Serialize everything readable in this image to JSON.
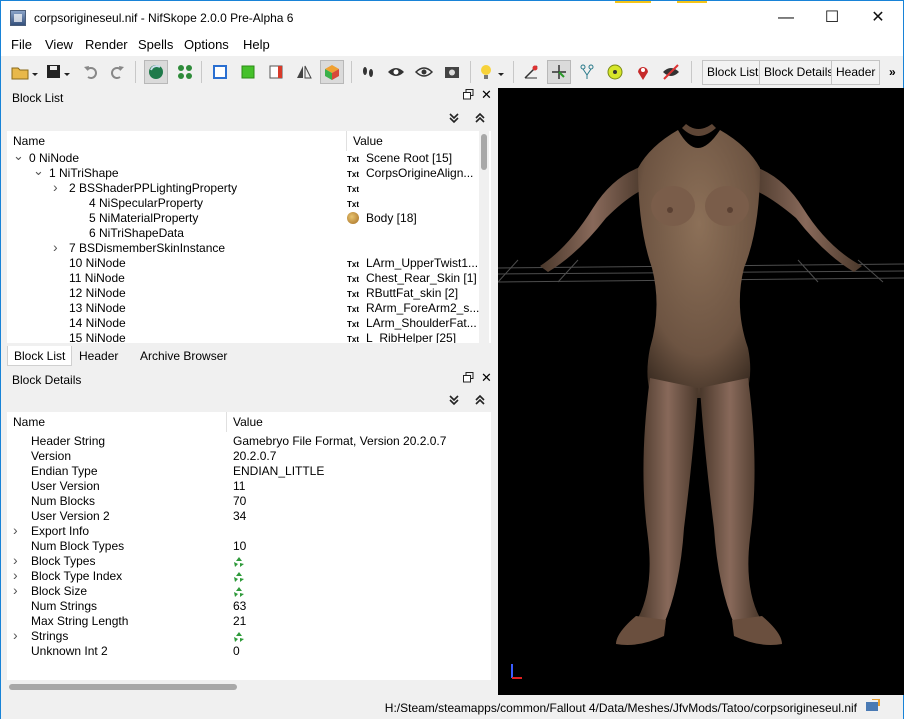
{
  "window": {
    "title": "corpsorigineseul.nif - NifSkope 2.0.0 Pre-Alpha 6",
    "controls": {
      "minimize": "—",
      "maximize": "☐",
      "close": "✕"
    }
  },
  "menu": [
    "File",
    "View",
    "Render",
    "Spells",
    "Options",
    "Help"
  ],
  "toolbar": {
    "icons": [
      "open-icon",
      "save-icon",
      "undo-icon",
      "redo-icon",
      "lighting-icon",
      "nodes-icon",
      "cube-front-icon",
      "cube-green-icon",
      "cube-side-icon",
      "mirror-icon",
      "cube-color-icon",
      "footprints-icon",
      "eye-icon",
      "eye-outline-icon",
      "screenshot-icon",
      "lightbulb-icon",
      "axes-red-icon",
      "axes-green-icon",
      "skeleton-icon",
      "target-icon",
      "marker-icon",
      "hide-icon"
    ],
    "block_list_label": "Block List",
    "block_details_label": "Block Details",
    "header_label": "Header",
    "more": "»"
  },
  "block_list": {
    "title": "Block List",
    "columns": {
      "name": "Name",
      "value": "Value"
    },
    "rows": [
      {
        "arrow": "⌄",
        "name": "0 NiNode",
        "vtype": "Txt",
        "value": "Scene Root [15]"
      },
      {
        "arrow": "⌄",
        "name": "1 NiTriShape",
        "vtype": "Txt",
        "value": "CorpsOrigineAlign..."
      },
      {
        "arrow": "›",
        "name": "2 BSShaderPPLightingProperty",
        "vtype": "Txt",
        "value": ""
      },
      {
        "arrow": "",
        "name": "4 NiSpecularProperty",
        "vtype": "Txt",
        "value": ""
      },
      {
        "arrow": "",
        "name": "5 NiMaterialProperty",
        "vtype": "palette",
        "value": "Body [18]"
      },
      {
        "arrow": "",
        "name": "6 NiTriShapeData",
        "vtype": "",
        "value": ""
      },
      {
        "arrow": "›",
        "name": "7 BSDismemberSkinInstance",
        "vtype": "",
        "value": ""
      },
      {
        "arrow": "",
        "name": "10 NiNode",
        "vtype": "Txt",
        "value": "LArm_UpperTwist1..."
      },
      {
        "arrow": "",
        "name": "11 NiNode",
        "vtype": "Txt",
        "value": "Chest_Rear_Skin [1]"
      },
      {
        "arrow": "",
        "name": "12 NiNode",
        "vtype": "Txt",
        "value": "RButtFat_skin [2]"
      },
      {
        "arrow": "",
        "name": "13 NiNode",
        "vtype": "Txt",
        "value": "RArm_ForeArm2_s..."
      },
      {
        "arrow": "",
        "name": "14 NiNode",
        "vtype": "Txt",
        "value": "LArm_ShoulderFat..."
      },
      {
        "arrow": "",
        "name": "15 NiNode",
        "vtype": "Txt",
        "value": "L_RibHelper [25]"
      }
    ],
    "tabs": [
      "Block List",
      "Header",
      "Archive Browser"
    ]
  },
  "block_details": {
    "title": "Block Details",
    "columns": {
      "name": "Name",
      "value": "Value"
    },
    "rows": [
      {
        "arrow": "",
        "name": "Header String",
        "value": "Gamebryo File Format, Version 20.2.0.7"
      },
      {
        "arrow": "",
        "name": "Version",
        "value": "20.2.0.7"
      },
      {
        "arrow": "",
        "name": "Endian Type",
        "value": "ENDIAN_LITTLE"
      },
      {
        "arrow": "",
        "name": "User Version",
        "value": "11"
      },
      {
        "arrow": "",
        "name": "Num Blocks",
        "value": "70"
      },
      {
        "arrow": "",
        "name": "User Version 2",
        "value": "34"
      },
      {
        "arrow": "›",
        "name": "Export Info",
        "value": ""
      },
      {
        "arrow": "",
        "name": "Num Block Types",
        "value": "10"
      },
      {
        "arrow": "›",
        "name": "Block Types",
        "value": "",
        "icon": true
      },
      {
        "arrow": "›",
        "name": "Block Type Index",
        "value": "",
        "icon": true
      },
      {
        "arrow": "›",
        "name": "Block Size",
        "value": "",
        "icon": true
      },
      {
        "arrow": "",
        "name": "Num Strings",
        "value": "63"
      },
      {
        "arrow": "",
        "name": "Max String Length",
        "value": "21"
      },
      {
        "arrow": "›",
        "name": "Strings",
        "value": "",
        "icon": true
      },
      {
        "arrow": "",
        "name": "Unknown Int 2",
        "value": "0"
      }
    ]
  },
  "status": {
    "path": "H:/Steam/steamapps/common/Fallout 4/Data/Meshes/JfvMods/Tatoo/corpsorigineseul.nif"
  },
  "colors": {
    "window_border": "#1883d7",
    "viewport_bg": "#000000",
    "skin": "#8a6b55",
    "grid": "#7a7a7a"
  }
}
